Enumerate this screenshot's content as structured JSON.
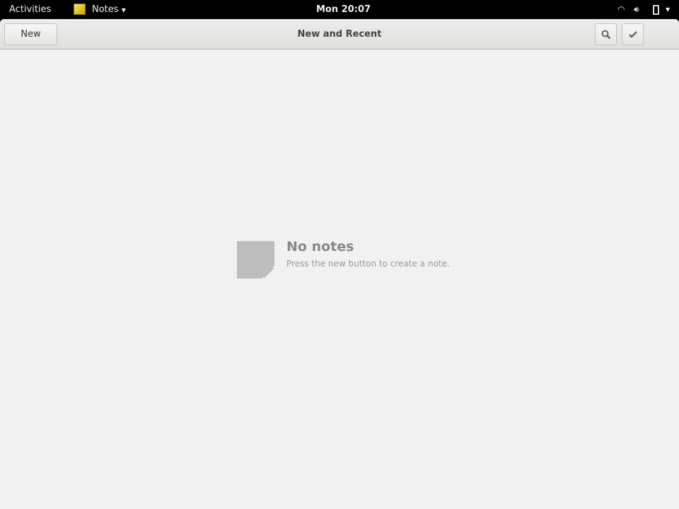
{
  "topbar": {
    "activities": "Activities",
    "app_menu": "Notes",
    "clock": "Mon 20:07"
  },
  "header": {
    "new_label": "New",
    "title": "New and Recent"
  },
  "empty": {
    "title": "No notes",
    "subtitle": "Press the new button to create a note."
  }
}
